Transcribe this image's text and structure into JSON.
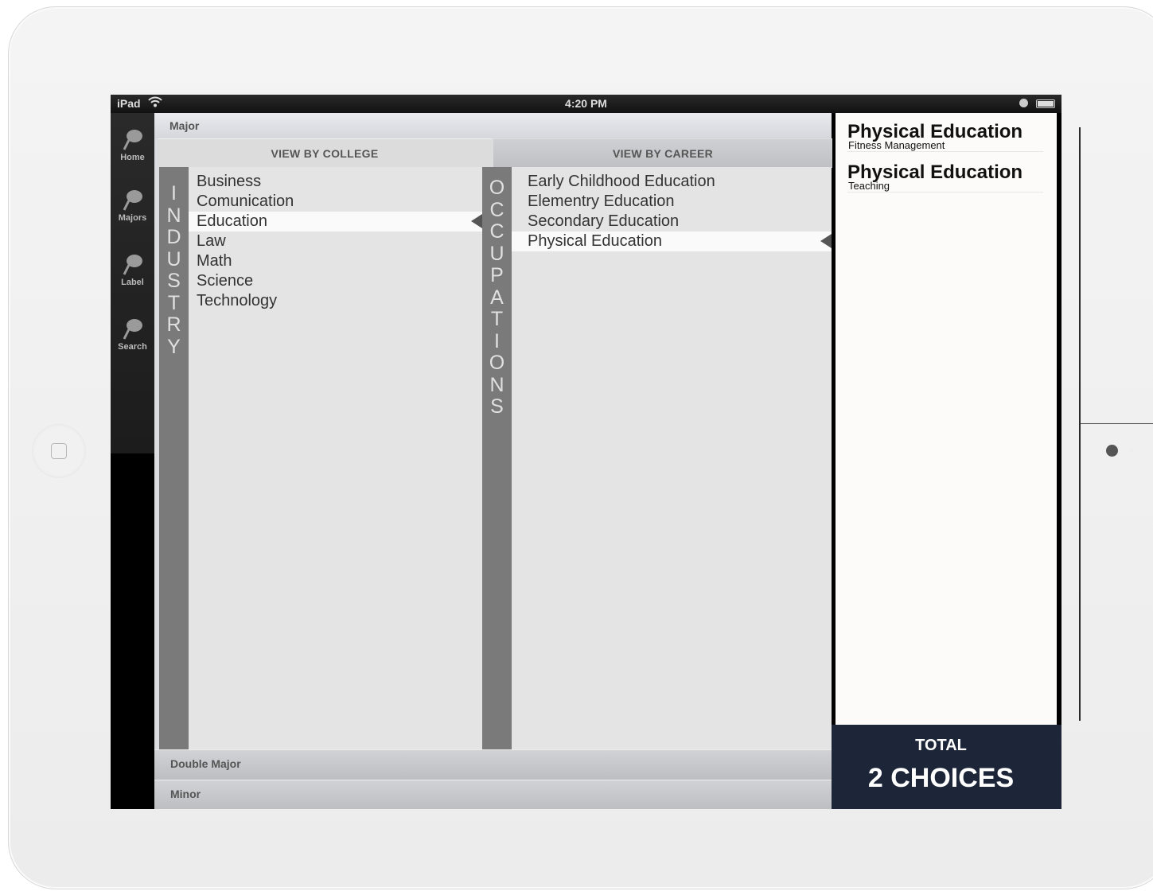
{
  "status_bar": {
    "carrier": "iPad",
    "time": "4:20 PM"
  },
  "nav": [
    {
      "label": "Home"
    },
    {
      "label": "Majors"
    },
    {
      "label": "Label"
    },
    {
      "label": "Search"
    }
  ],
  "header": {
    "major_label": "Major",
    "tab_college": "VIEW BY COLLEGE",
    "tab_career": "VIEW BY CAREER"
  },
  "industry": {
    "strip_label": [
      "I",
      "N",
      "D",
      "U",
      "S",
      "T",
      "R",
      "Y"
    ],
    "items": [
      "Business",
      "Comunication",
      "Education",
      "Law",
      "Math",
      "Science",
      "Technology"
    ],
    "selected": "Education"
  },
  "occupations": {
    "strip_label": [
      "O",
      "C",
      "C",
      "U",
      "P",
      "A",
      "T",
      "I",
      "O",
      "N",
      "S"
    ],
    "items": [
      "Early Childhood Education",
      "Elementry Education",
      "Secondary Education",
      "Physical Education"
    ],
    "selected": "Physical Education"
  },
  "sections": {
    "double_major": "Double Major",
    "minor": "Minor"
  },
  "choices": [
    {
      "title": "Physical Education",
      "subtitle": "Fitness Management"
    },
    {
      "title": "Physical Education",
      "subtitle": "Teaching"
    }
  ],
  "total": {
    "label": "TOTAL",
    "value": "2 CHOICES"
  },
  "colors": {
    "total_bg": "#1c2638",
    "strip": "#7a7a7a"
  }
}
